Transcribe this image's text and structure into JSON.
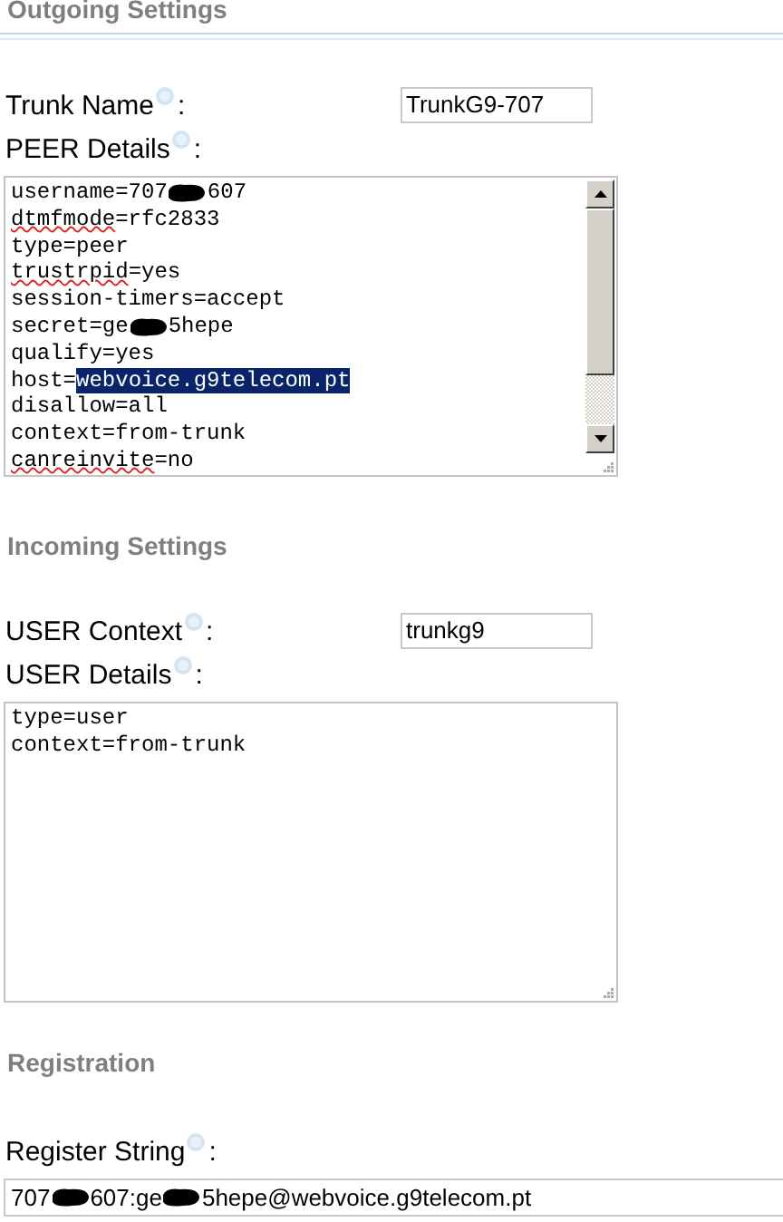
{
  "sections": [
    {
      "title": "Outgoing Settings",
      "fields": [
        {
          "kind": "input",
          "label": "Trunk Name",
          "colon": ":",
          "value": "TrunkG9-707"
        },
        {
          "kind": "textarea",
          "label": "PEER Details",
          "colon": ":",
          "scrollbar": true,
          "lines": [
            [
              {
                "kind": "text",
                "text": "username=707"
              },
              {
                "kind": "redacted"
              },
              {
                "kind": "text",
                "text": "607"
              }
            ],
            [
              {
                "kind": "misspelled",
                "text": "dtmfmode"
              },
              {
                "kind": "text",
                "text": "=rfc2833"
              }
            ],
            [
              {
                "kind": "text",
                "text": "type=peer"
              }
            ],
            [
              {
                "kind": "misspelled",
                "text": "trustrpid"
              },
              {
                "kind": "text",
                "text": "=yes"
              }
            ],
            [
              {
                "kind": "text",
                "text": "session-timers=accept"
              }
            ],
            [
              {
                "kind": "text",
                "text": "secret=ge"
              },
              {
                "kind": "redacted"
              },
              {
                "kind": "text",
                "text": "5hepe"
              }
            ],
            [
              {
                "kind": "text",
                "text": "qualify=yes"
              }
            ],
            [
              {
                "kind": "text",
                "text": "host="
              },
              {
                "kind": "selected",
                "text": "webvoice.g9telecom.pt"
              }
            ],
            [
              {
                "kind": "text",
                "text": "disallow=all"
              }
            ],
            [
              {
                "kind": "text",
                "text": "context=from-trunk"
              }
            ],
            [
              {
                "kind": "misspelled",
                "text": "canreinvite"
              },
              {
                "kind": "text",
                "text": "=no"
              }
            ]
          ]
        }
      ]
    },
    {
      "title": "Incoming Settings",
      "fields": [
        {
          "kind": "input",
          "label": "USER Context",
          "colon": ":",
          "value": "trunkg9"
        },
        {
          "kind": "textarea",
          "label": "USER Details",
          "colon": ":",
          "scrollbar": false,
          "lines": [
            [
              {
                "kind": "text",
                "text": "type=user"
              }
            ],
            [
              {
                "kind": "text",
                "text": "context=from-trunk"
              }
            ]
          ]
        }
      ]
    },
    {
      "title": "Registration",
      "fields": [
        {
          "kind": "wide",
          "label": "Register String",
          "colon": ":",
          "parts": [
            {
              "kind": "text",
              "text": "707"
            },
            {
              "kind": "redacted"
            },
            {
              "kind": "text",
              "text": "607:ge"
            },
            {
              "kind": "redacted"
            },
            {
              "kind": "text",
              "text": "5hepe@webvoice.g9telecom.pt"
            }
          ]
        }
      ]
    }
  ]
}
